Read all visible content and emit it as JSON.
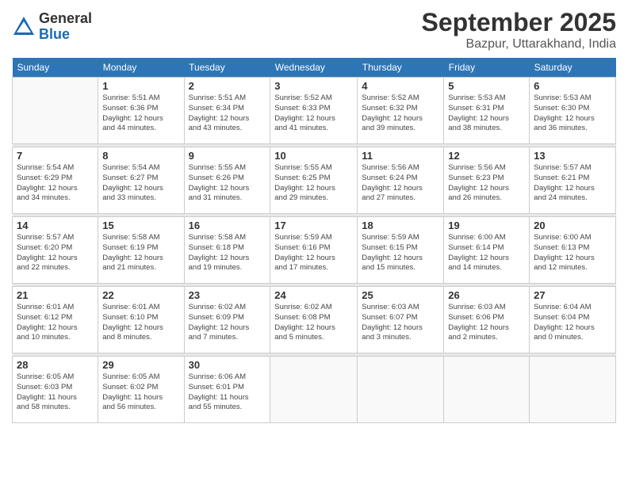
{
  "logo": {
    "general": "General",
    "blue": "Blue"
  },
  "title": "September 2025",
  "location": "Bazpur, Uttarakhand, India",
  "days_of_week": [
    "Sunday",
    "Monday",
    "Tuesday",
    "Wednesday",
    "Thursday",
    "Friday",
    "Saturday"
  ],
  "weeks": [
    [
      {
        "day": "",
        "info": ""
      },
      {
        "day": "1",
        "info": "Sunrise: 5:51 AM\nSunset: 6:36 PM\nDaylight: 12 hours\nand 44 minutes."
      },
      {
        "day": "2",
        "info": "Sunrise: 5:51 AM\nSunset: 6:34 PM\nDaylight: 12 hours\nand 43 minutes."
      },
      {
        "day": "3",
        "info": "Sunrise: 5:52 AM\nSunset: 6:33 PM\nDaylight: 12 hours\nand 41 minutes."
      },
      {
        "day": "4",
        "info": "Sunrise: 5:52 AM\nSunset: 6:32 PM\nDaylight: 12 hours\nand 39 minutes."
      },
      {
        "day": "5",
        "info": "Sunrise: 5:53 AM\nSunset: 6:31 PM\nDaylight: 12 hours\nand 38 minutes."
      },
      {
        "day": "6",
        "info": "Sunrise: 5:53 AM\nSunset: 6:30 PM\nDaylight: 12 hours\nand 36 minutes."
      }
    ],
    [
      {
        "day": "7",
        "info": "Sunrise: 5:54 AM\nSunset: 6:29 PM\nDaylight: 12 hours\nand 34 minutes."
      },
      {
        "day": "8",
        "info": "Sunrise: 5:54 AM\nSunset: 6:27 PM\nDaylight: 12 hours\nand 33 minutes."
      },
      {
        "day": "9",
        "info": "Sunrise: 5:55 AM\nSunset: 6:26 PM\nDaylight: 12 hours\nand 31 minutes."
      },
      {
        "day": "10",
        "info": "Sunrise: 5:55 AM\nSunset: 6:25 PM\nDaylight: 12 hours\nand 29 minutes."
      },
      {
        "day": "11",
        "info": "Sunrise: 5:56 AM\nSunset: 6:24 PM\nDaylight: 12 hours\nand 27 minutes."
      },
      {
        "day": "12",
        "info": "Sunrise: 5:56 AM\nSunset: 6:23 PM\nDaylight: 12 hours\nand 26 minutes."
      },
      {
        "day": "13",
        "info": "Sunrise: 5:57 AM\nSunset: 6:21 PM\nDaylight: 12 hours\nand 24 minutes."
      }
    ],
    [
      {
        "day": "14",
        "info": "Sunrise: 5:57 AM\nSunset: 6:20 PM\nDaylight: 12 hours\nand 22 minutes."
      },
      {
        "day": "15",
        "info": "Sunrise: 5:58 AM\nSunset: 6:19 PM\nDaylight: 12 hours\nand 21 minutes."
      },
      {
        "day": "16",
        "info": "Sunrise: 5:58 AM\nSunset: 6:18 PM\nDaylight: 12 hours\nand 19 minutes."
      },
      {
        "day": "17",
        "info": "Sunrise: 5:59 AM\nSunset: 6:16 PM\nDaylight: 12 hours\nand 17 minutes."
      },
      {
        "day": "18",
        "info": "Sunrise: 5:59 AM\nSunset: 6:15 PM\nDaylight: 12 hours\nand 15 minutes."
      },
      {
        "day": "19",
        "info": "Sunrise: 6:00 AM\nSunset: 6:14 PM\nDaylight: 12 hours\nand 14 minutes."
      },
      {
        "day": "20",
        "info": "Sunrise: 6:00 AM\nSunset: 6:13 PM\nDaylight: 12 hours\nand 12 minutes."
      }
    ],
    [
      {
        "day": "21",
        "info": "Sunrise: 6:01 AM\nSunset: 6:12 PM\nDaylight: 12 hours\nand 10 minutes."
      },
      {
        "day": "22",
        "info": "Sunrise: 6:01 AM\nSunset: 6:10 PM\nDaylight: 12 hours\nand 8 minutes."
      },
      {
        "day": "23",
        "info": "Sunrise: 6:02 AM\nSunset: 6:09 PM\nDaylight: 12 hours\nand 7 minutes."
      },
      {
        "day": "24",
        "info": "Sunrise: 6:02 AM\nSunset: 6:08 PM\nDaylight: 12 hours\nand 5 minutes."
      },
      {
        "day": "25",
        "info": "Sunrise: 6:03 AM\nSunset: 6:07 PM\nDaylight: 12 hours\nand 3 minutes."
      },
      {
        "day": "26",
        "info": "Sunrise: 6:03 AM\nSunset: 6:06 PM\nDaylight: 12 hours\nand 2 minutes."
      },
      {
        "day": "27",
        "info": "Sunrise: 6:04 AM\nSunset: 6:04 PM\nDaylight: 12 hours\nand 0 minutes."
      }
    ],
    [
      {
        "day": "28",
        "info": "Sunrise: 6:05 AM\nSunset: 6:03 PM\nDaylight: 11 hours\nand 58 minutes."
      },
      {
        "day": "29",
        "info": "Sunrise: 6:05 AM\nSunset: 6:02 PM\nDaylight: 11 hours\nand 56 minutes."
      },
      {
        "day": "30",
        "info": "Sunrise: 6:06 AM\nSunset: 6:01 PM\nDaylight: 11 hours\nand 55 minutes."
      },
      {
        "day": "",
        "info": ""
      },
      {
        "day": "",
        "info": ""
      },
      {
        "day": "",
        "info": ""
      },
      {
        "day": "",
        "info": ""
      }
    ]
  ]
}
